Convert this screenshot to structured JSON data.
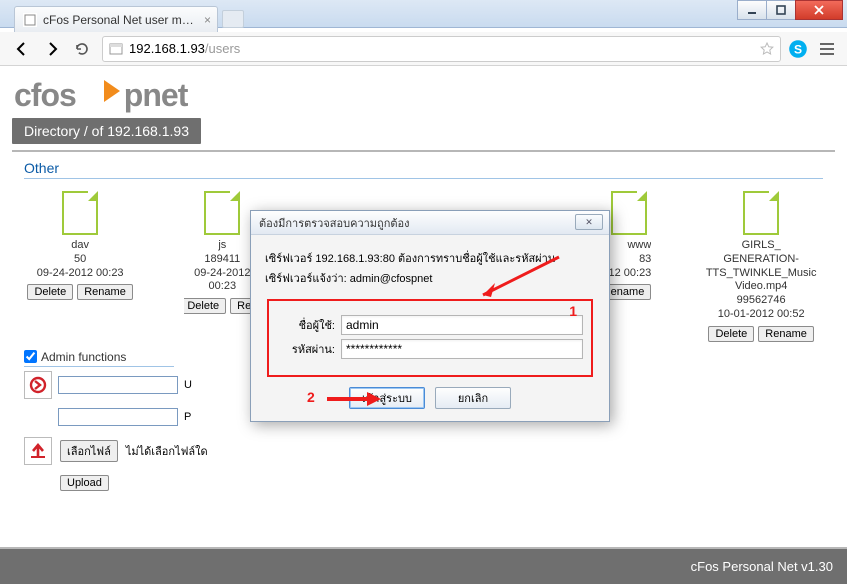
{
  "browser": {
    "tab_title": "cFos Personal Net user man",
    "url_host": "192.168.1.93",
    "url_path": "/users"
  },
  "logo": {
    "left": "cfos",
    "right": "pnet"
  },
  "breadcrumb": "Directory / of 192.168.1.93",
  "section": {
    "other": "Other"
  },
  "files": [
    {
      "name": "dav",
      "size": "50",
      "date": "09-24-2012 00:23"
    },
    {
      "name": "js",
      "size": "189411",
      "date": "09-24-2012 00:23"
    },
    {
      "name": "www",
      "size": "83",
      "date": "2012 00:23"
    },
    {
      "name": "GIRLS_\nGENERATION-\nTTS_TWINKLE_Music\nVideo.mp4",
      "size": "99562746",
      "date": "10-01-2012 00:52"
    }
  ],
  "buttons": {
    "delete": "Delete",
    "rename": "Rename",
    "choose_file": "เลือกไฟล์",
    "upload": "Upload"
  },
  "admin": {
    "label": "Admin functions",
    "field1_label": "U",
    "field2_label": "P",
    "no_file": "ไม่ได้เลือกไฟล์ใด"
  },
  "auth": {
    "title": "ต้องมีการตรวจสอบความถูกต้อง",
    "line1": "เซิร์ฟเวอร์ 192.168.1.93:80 ต้องการทราบชื่อผู้ใช้และรหัสผ่าน",
    "line2": "เซิร์ฟเวอร์แจ้งว่า: admin@cfospnet",
    "user_label": "ชื่อผู้ใช้:",
    "pass_label": "รหัสผ่าน:",
    "user_value": "admin",
    "pass_value": "************",
    "login": "เข้าสู่ระบบ",
    "cancel": "ยกเลิก",
    "ann1": "1",
    "ann2": "2"
  },
  "footer": "cFos Personal Net v1.30"
}
